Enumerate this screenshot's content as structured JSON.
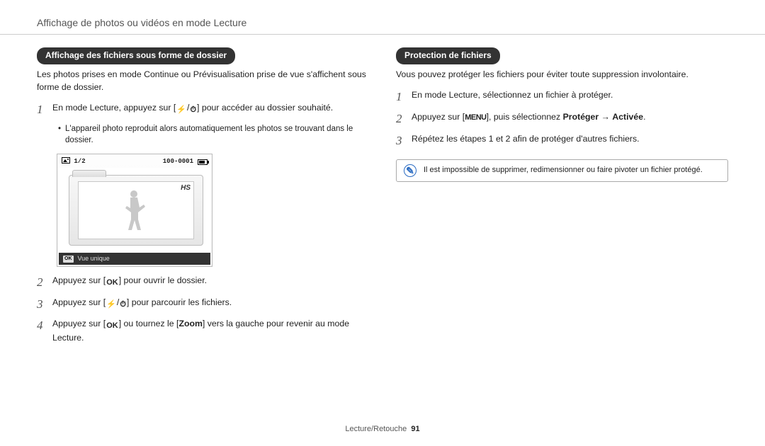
{
  "header": "Affichage de photos ou vidéos en mode Lecture",
  "left": {
    "pill": "Affichage des fichiers sous forme de dossier",
    "intro": "Les photos prises en mode Continue ou Prévisualisation prise de vue s'affichent sous forme de dossier.",
    "step1_a": "En mode Lecture, appuyez sur [",
    "step1_b": "] pour accéder au dossier souhaité.",
    "bullet": "L'appareil photo reproduit alors automatiquement les photos se trouvant dans le dossier.",
    "lcd": {
      "counter": "1/2",
      "file_no": "100-0001",
      "badge": "HS",
      "bottom_label": "Vue unique",
      "ok": "OK"
    },
    "step2_a": "Appuyez sur [",
    "step2_b": "] pour ouvrir le dossier.",
    "step3_a": "Appuyez sur [",
    "step3_b": "] pour parcourir les fichiers.",
    "step4_a": "Appuyez sur [",
    "step4_b": "] ou tournez le [",
    "step4_zoom": "Zoom",
    "step4_c": "] vers la gauche pour revenir au mode Lecture."
  },
  "right": {
    "pill": "Protection de fichiers",
    "intro": "Vous pouvez protéger les fichiers pour éviter toute suppression involontaire.",
    "step1": "En mode Lecture, sélectionnez un fichier à protéger.",
    "step2_a": "Appuyez sur [",
    "step2_menu": "MENU",
    "step2_b": "], puis sélectionnez ",
    "step2_bold1": "Protéger",
    "step2_arrow": " → ",
    "step2_bold2": "Activée",
    "step2_end": ".",
    "step3": "Répétez les étapes 1 et 2 afin de protéger d'autres fichiers.",
    "note": "Il est impossible de supprimer, redimensionner ou faire pivoter un fichier protégé."
  },
  "footer": {
    "section": "Lecture/Retouche",
    "page": "91"
  },
  "glyphs": {
    "flash": "⚡",
    "timer": "⏱",
    "ok": "OK",
    "note_glyph": "✎"
  }
}
